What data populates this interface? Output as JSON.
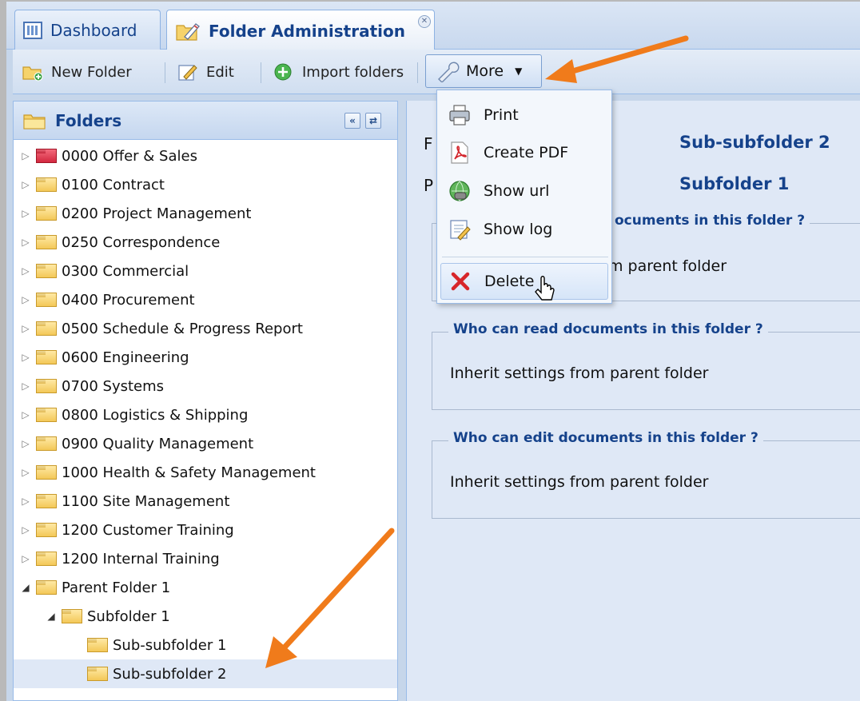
{
  "tabs": [
    {
      "label": "Dashboard",
      "icon": "dashboard-icon"
    },
    {
      "label": "Folder Administration",
      "icon": "folder-edit-icon",
      "closable": true
    }
  ],
  "toolbar": {
    "new_folder": "New Folder",
    "edit": "Edit",
    "import_folders": "Import folders",
    "more": "More"
  },
  "menu": {
    "print": "Print",
    "create_pdf": "Create PDF",
    "show_url": "Show url",
    "show_log": "Show log",
    "delete": "Delete"
  },
  "folders_panel": {
    "title": "Folders",
    "items": [
      {
        "label": "0000 Offer & Sales",
        "color": "red"
      },
      {
        "label": "0100 Contract",
        "color": "yellow"
      },
      {
        "label": "0200 Project Management",
        "color": "yellow"
      },
      {
        "label": "0250 Correspondence",
        "color": "yellow"
      },
      {
        "label": "0300 Commercial",
        "color": "yellow"
      },
      {
        "label": "0400 Procurement",
        "color": "yellow"
      },
      {
        "label": "0500 Schedule & Progress Report",
        "color": "yellow"
      },
      {
        "label": "0600 Engineering",
        "color": "yellow"
      },
      {
        "label": "0700 Systems",
        "color": "yellow"
      },
      {
        "label": "0800 Logistics & Shipping",
        "color": "yellow"
      },
      {
        "label": "0900 Quality Management",
        "color": "yellow"
      },
      {
        "label": "1000 Health & Safety Management",
        "color": "yellow"
      },
      {
        "label": "1100 Site Management",
        "color": "yellow"
      },
      {
        "label": "1200 Customer Training",
        "color": "yellow"
      },
      {
        "label": "1200 Internal Training",
        "color": "yellow"
      },
      {
        "label": "Parent Folder 1",
        "color": "yellow",
        "expanded": true
      },
      {
        "label": "Subfolder 1",
        "color": "yellow",
        "expanded": true
      },
      {
        "label": "Sub-subfolder 1",
        "color": "yellow"
      },
      {
        "label": "Sub-subfolder 2",
        "color": "yellow",
        "selected": true
      }
    ]
  },
  "detail": {
    "label_1": "F",
    "value_1": "Sub-subfolder 2",
    "label_2": "P",
    "value_2": "Subfolder 1",
    "fieldset_1_legend": "ocuments in this folder ?",
    "fieldset_1_text": "m parent folder",
    "fieldset_2_legend": "Who can read documents in this folder ?",
    "fieldset_2_text": "Inherit settings from parent folder",
    "fieldset_3_legend": "Who can edit documents in this folder ?",
    "fieldset_3_text": "Inherit settings from parent folder"
  },
  "colors": {
    "accent_blue": "#15428b",
    "arrow_orange": "#f07b1b",
    "panel_bg": "#dfe8f6"
  }
}
